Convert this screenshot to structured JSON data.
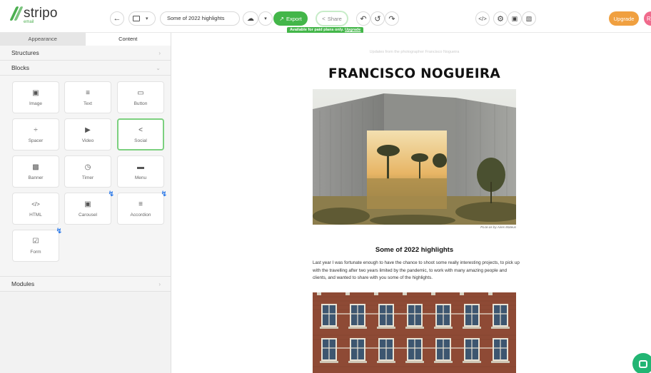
{
  "app": {
    "logo": "stripo",
    "logo_sub": "email"
  },
  "toolbar": {
    "back_icon": "arrow-left-icon",
    "email_name": "Some of 2022 highlights",
    "export_label": "Export",
    "share_label": "Share",
    "paid_note": "Available for paid plans only.",
    "paid_link": "Upgrade",
    "upgrade_label": "Upgrade",
    "avatar_initial": "R"
  },
  "panel": {
    "tabs": [
      {
        "label": "Appearance"
      },
      {
        "label": "Content"
      }
    ],
    "sections": {
      "structures": "Structures",
      "blocks": "Blocks",
      "modules": "Modules"
    },
    "blocks": [
      {
        "label": "Image",
        "icon": "image-icon"
      },
      {
        "label": "Text",
        "icon": "text-icon"
      },
      {
        "label": "Button",
        "icon": "button-icon"
      },
      {
        "label": "Spacer",
        "icon": "spacer-icon"
      },
      {
        "label": "Video",
        "icon": "video-icon"
      },
      {
        "label": "Social",
        "icon": "share-icon"
      },
      {
        "label": "Banner",
        "icon": "banner-icon"
      },
      {
        "label": "Timer",
        "icon": "timer-icon"
      },
      {
        "label": "Menu",
        "icon": "menu-icon"
      },
      {
        "label": "HTML",
        "icon": "code-icon"
      },
      {
        "label": "Carousel",
        "icon": "carousel-icon"
      },
      {
        "label": "Accordion",
        "icon": "accordion-icon"
      },
      {
        "label": "Form",
        "icon": "form-icon"
      }
    ]
  },
  "email": {
    "preheader": "Updates from the photographer Francisco Nogueira",
    "title": "FRANCISCO NOGUEIRA",
    "caption": "Pa.te.os by Aires Mateus",
    "heading": "Some of 2022 highlights",
    "body": "Last year I was fortunate enough to have the chance to shoot some really interesting projects, to pick up with the travelling after two years limited by the pandemic, to work with many amazing people and clients, and wanted to share with you some of the highlights."
  },
  "colors": {
    "accent": "#43b649",
    "upgrade": "#f0a040",
    "bolt": "#2e7bea"
  }
}
